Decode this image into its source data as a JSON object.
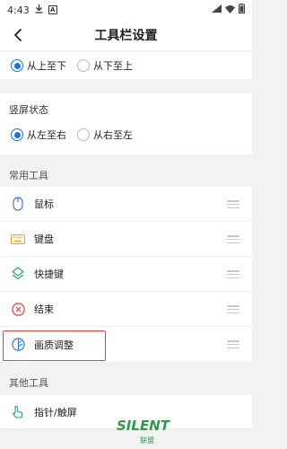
{
  "status_bar": {
    "time": "4:43",
    "download_icon": "download-icon",
    "app_badge": "A",
    "signal_icon": "signal-icon",
    "wifi_icon": "wifi-icon",
    "battery_icon": "battery-icon"
  },
  "header": {
    "title": "工具栏设置",
    "back_icon": "back-arrow-icon"
  },
  "direction_landscape": {
    "options": [
      {
        "label": "从上至下",
        "checked": true
      },
      {
        "label": "从下至上",
        "checked": false
      }
    ]
  },
  "direction_portrait": {
    "title": "竖屏状态",
    "options": [
      {
        "label": "从左至右",
        "checked": true
      },
      {
        "label": "从右至左",
        "checked": false
      }
    ]
  },
  "common_tools": {
    "title": "常用工具",
    "items": [
      {
        "label": "鼠标",
        "icon": "mouse-icon"
      },
      {
        "label": "键盘",
        "icon": "keyboard-icon"
      },
      {
        "label": "快捷键",
        "icon": "shortcut-icon"
      },
      {
        "label": "结束",
        "icon": "close-circle-icon"
      },
      {
        "label": "画质调整",
        "icon": "image-quality-icon"
      }
    ]
  },
  "other_tools": {
    "title": "其他工具",
    "items": [
      {
        "label": "指针/触屏",
        "icon": "touch-pointer-icon"
      }
    ]
  },
  "watermark": {
    "text": "SILENT",
    "subtext": "联盟"
  },
  "colors": {
    "accent": "#1a73e8",
    "highlight": "#e0443a",
    "background": "#f2f2f4"
  }
}
